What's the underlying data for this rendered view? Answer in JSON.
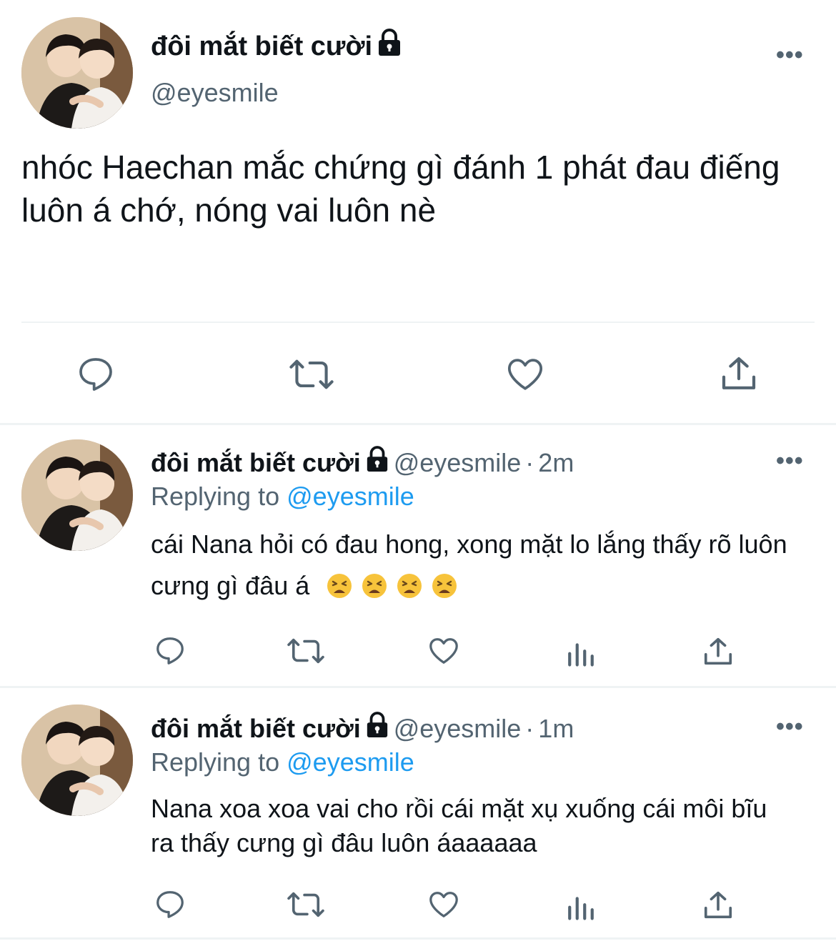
{
  "main_tweet": {
    "display_name": "đôi mắt biết cười",
    "handle": "@eyesmile",
    "text": "nhóc Haechan mắc chứng gì đánh 1 phát đau điếng luôn á chớ, nóng vai luôn nè",
    "actions": [
      "reply-icon",
      "retweet-icon",
      "like-icon",
      "share-icon"
    ]
  },
  "replies": [
    {
      "display_name": "đôi mắt biết cười",
      "handle": "@eyesmile",
      "dot": "·",
      "time": "2m",
      "replying_prefix": "Replying to",
      "replying_to": "@eyesmile",
      "text": "cái Nana hỏi có đau hong, xong mặt lo lắng thấy rõ luôn cưng gì đâu á",
      "emoji": [
        "tired-face",
        "tired-face",
        "tired-face",
        "tired-face"
      ],
      "actions": [
        "reply-icon",
        "retweet-icon",
        "like-icon",
        "analytics-icon",
        "share-icon"
      ]
    },
    {
      "display_name": "đôi mắt biết cười",
      "handle": "@eyesmile",
      "dot": "·",
      "time": "1m",
      "replying_prefix": "Replying to",
      "replying_to": "@eyesmile",
      "text": "Nana xoa xoa vai cho rồi cái mặt xụ xuống cái môi bĩu ra thấy cưng gì đâu luôn áaaaaaa",
      "actions": [
        "reply-icon",
        "retweet-icon",
        "like-icon",
        "analytics-icon",
        "share-icon"
      ]
    }
  ],
  "more_label": "•••",
  "colors": {
    "text": "#0f1419",
    "secondary": "#536471",
    "link": "#1d9bf0",
    "divider": "#eff3f4"
  }
}
